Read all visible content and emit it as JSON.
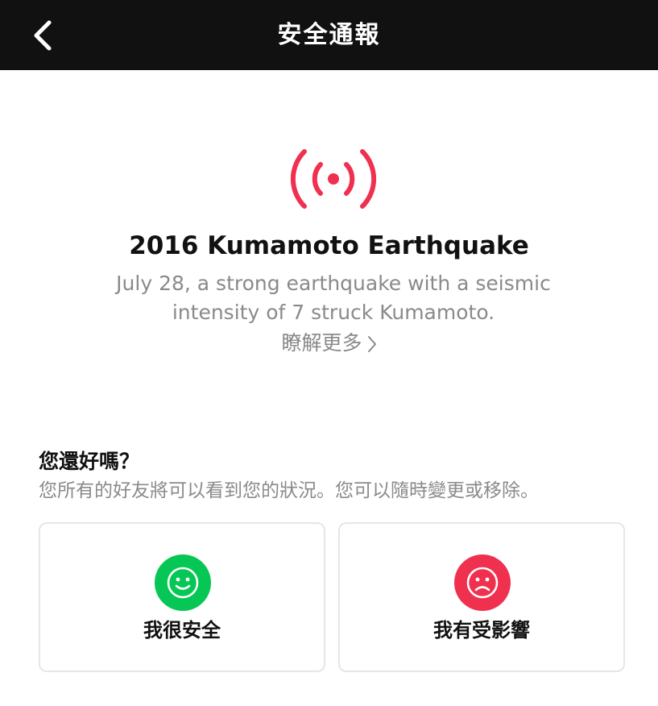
{
  "nav": {
    "title": "安全通報",
    "back_icon": "chevron-left-icon"
  },
  "alert": {
    "icon": "broadcast-icon",
    "icon_color": "#f0304f",
    "title": "2016 Kumamoto Earthquake",
    "description": "July 28, a strong earthquake with a seismic intensity of 7 struck Kumamoto.",
    "learn_more": "瞭解更多"
  },
  "status_question": {
    "title": "您還好嗎？",
    "subtitle": "您所有的好友將可以看到您的狀況。您可以隨時變更或移除。"
  },
  "options": [
    {
      "label": "我很安全",
      "icon": "smile-icon",
      "color": "#06c755"
    },
    {
      "label": "我有受影響",
      "icon": "frown-icon",
      "color": "#f0304f"
    }
  ]
}
